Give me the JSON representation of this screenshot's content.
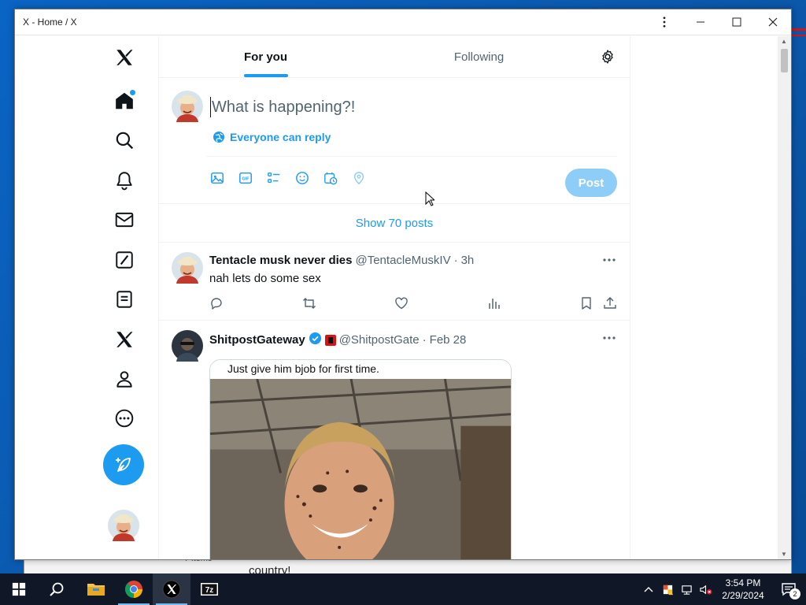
{
  "window": {
    "title": "X - Home / X"
  },
  "tabs": [
    {
      "label": "For you",
      "active": true
    },
    {
      "label": "Following",
      "active": false
    }
  ],
  "composer": {
    "placeholder": "What is happening?!",
    "reply_setting": "Everyone can reply",
    "post_label": "Post",
    "tools": [
      "image-icon",
      "gif-icon",
      "poll-icon",
      "emoji-icon",
      "schedule-icon",
      "location-icon"
    ]
  },
  "show_posts": "Show 70 posts",
  "tweets": [
    {
      "name": "Tentacle musk never dies",
      "handle": "@TentacleMuskIV",
      "separator": "·",
      "time": "3h",
      "text": "nah lets do some sex"
    },
    {
      "name": "ShitpostGateway",
      "verified": true,
      "handle": "@ShitpostGate",
      "separator": "·",
      "time": "Feb 28",
      "media_caption": "Just give him bjob for first time."
    }
  ],
  "background_peek": {
    "text": "country!",
    "items_label": "7 items"
  },
  "taskbar": {
    "time": "3:54 PM",
    "date": "2/29/2024",
    "notification_count": "2",
    "apps": [
      "start-icon",
      "search-icon",
      "file-explorer-icon",
      "chrome-icon",
      "x-app-icon",
      "7zip-icon"
    ]
  },
  "colors": {
    "accent": "#1d9bf0",
    "post_disabled": "#8ecdf8",
    "text_primary": "#0f1419",
    "text_secondary": "#536471"
  }
}
